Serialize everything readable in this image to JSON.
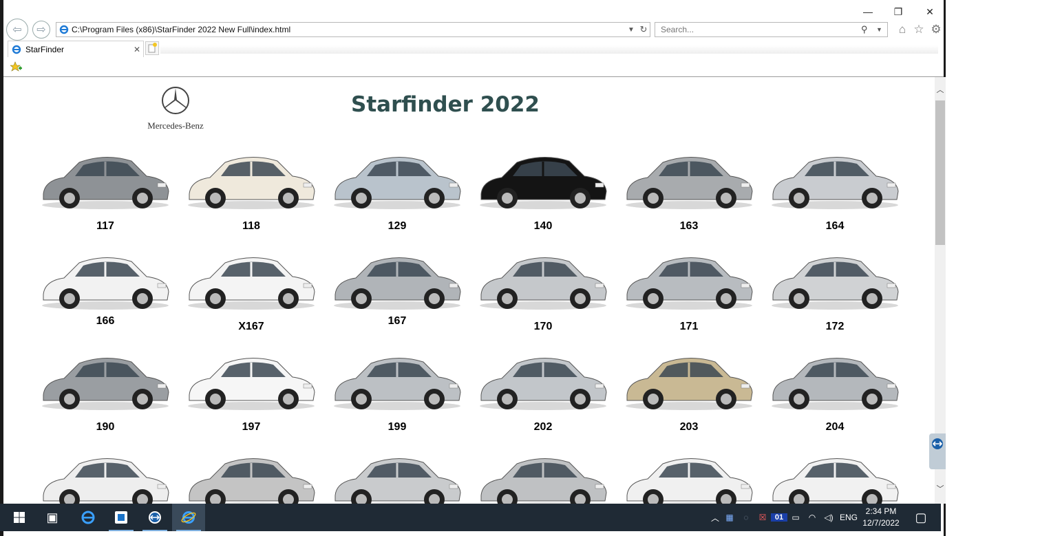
{
  "window": {
    "minimize_glyph": "—",
    "restore_glyph": "❐",
    "close_glyph": "✕"
  },
  "toolbar": {
    "address": "C:\\Program Files (x86)\\StarFinder 2022 New Full\\index.html",
    "search_placeholder": "Search..."
  },
  "tabs": [
    {
      "label": "StarFinder"
    }
  ],
  "page": {
    "brand": "Mercedes-Benz",
    "title": "Starfinder 2022"
  },
  "cars": [
    {
      "label": "117",
      "color": "#8e9296"
    },
    {
      "label": "118",
      "color": "#efe9dc"
    },
    {
      "label": "129",
      "color": "#b9c3cc"
    },
    {
      "label": "140",
      "color": "#141414"
    },
    {
      "label": "163",
      "color": "#a8abae"
    },
    {
      "label": "164",
      "color": "#c9ccd0"
    },
    {
      "label": "166",
      "color": "#f2f2f2"
    },
    {
      "label": "X167",
      "color": "#f4f4f4"
    },
    {
      "label": "167",
      "color": "#b0b4b8"
    },
    {
      "label": "170",
      "color": "#c5c8cb"
    },
    {
      "label": "171",
      "color": "#b8bcc0"
    },
    {
      "label": "172",
      "color": "#d0d2d4"
    },
    {
      "label": "190",
      "color": "#9a9ea2"
    },
    {
      "label": "197",
      "color": "#f6f6f6"
    },
    {
      "label": "199",
      "color": "#bcc0c4"
    },
    {
      "label": "202",
      "color": "#c2c6ca"
    },
    {
      "label": "203",
      "color": "#c9b994"
    },
    {
      "label": "204",
      "color": "#b4b8bc"
    },
    {
      "label": "",
      "color": "#eeeeee"
    },
    {
      "label": "",
      "color": "#c4c4c4"
    },
    {
      "label": "",
      "color": "#c9cbcd"
    },
    {
      "label": "",
      "color": "#bfc1c3"
    },
    {
      "label": "",
      "color": "#f0f0f0"
    },
    {
      "label": "",
      "color": "#f1f1f1"
    }
  ],
  "taskbar": {
    "language": "ENG",
    "time": "2:34 PM",
    "date": "12/7/2022"
  }
}
